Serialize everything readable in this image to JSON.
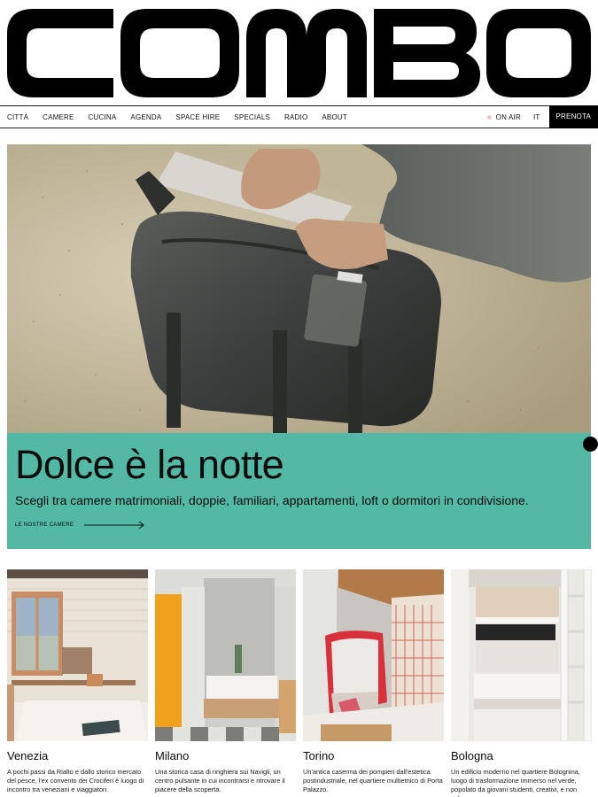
{
  "brand": {
    "logo_text": "COMBO"
  },
  "nav": {
    "items": [
      {
        "label": "CITTÀ"
      },
      {
        "label": "CAMERE"
      },
      {
        "label": "CUCINA"
      },
      {
        "label": "AGENDA"
      },
      {
        "label": "SPACE HIRE"
      },
      {
        "label": "SPECIALS"
      },
      {
        "label": "RADIO"
      },
      {
        "label": "ABOUT"
      }
    ],
    "on_air": "ON AIR",
    "language": "IT",
    "book": "PRENOTA"
  },
  "hero": {
    "title": "Dolce è la notte",
    "subtitle": "Scegli tra camere matrimoniali, doppie, familiari, appartamenti, loft o dormitori in condivisione.",
    "link_label": "LE NOSTRE CAMERE",
    "panel_color": "#52b9a4"
  },
  "cities": [
    {
      "name": "Venezia",
      "description": "A pochi passi da Rialto e dallo storico mercato del pesce, l'ex convento dei Crociferi è luogo di incontro tra veneziani e viaggiatori."
    },
    {
      "name": "Milano",
      "description": "Una storica casa di ringhiera sui Navigli, un centro pulsante in cui incontrarsi e ritrovare il piacere della scoperta."
    },
    {
      "name": "Torino",
      "description": "Un'antica caserma dei pompieri dall'estetica postindustriale, nel quartiere multietnico di Porta Palazzo."
    },
    {
      "name": "Bologna",
      "description": "Un edificio moderno nel quartiere Bolognina, luogo di trasformazione immerso nel verde, popolato da giovani studenti, creativi, e non solo."
    }
  ]
}
